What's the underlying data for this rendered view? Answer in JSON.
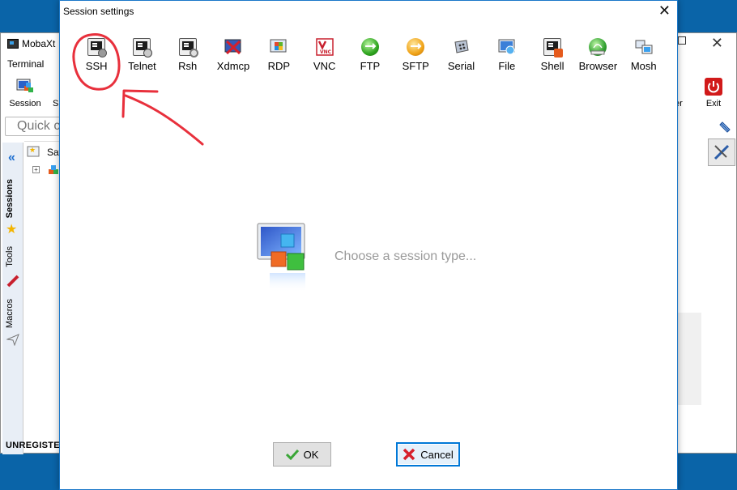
{
  "background_window": {
    "title": "MobaXt",
    "menu": "Terminal",
    "tools": [
      {
        "label": "Session",
        "icon": "session-icon"
      },
      {
        "label": "S",
        "icon": "servers-icon"
      },
      {
        "label": "er",
        "icon": "viewer-icon"
      },
      {
        "label": "Exit",
        "icon": "power-icon"
      }
    ],
    "quick_connect_placeholder": "Quick c",
    "saved_sessions_label": "Sav",
    "side_tabs": [
      "Sessions",
      "Tools",
      "Macros"
    ],
    "status": "UNREGISTER"
  },
  "dialog": {
    "title": "Session settings",
    "session_types": [
      {
        "label": "SSH",
        "icon": "ssh-icon"
      },
      {
        "label": "Telnet",
        "icon": "telnet-icon"
      },
      {
        "label": "Rsh",
        "icon": "rsh-icon"
      },
      {
        "label": "Xdmcp",
        "icon": "xdmcp-icon"
      },
      {
        "label": "RDP",
        "icon": "rdp-icon"
      },
      {
        "label": "VNC",
        "icon": "vnc-icon"
      },
      {
        "label": "FTP",
        "icon": "ftp-icon"
      },
      {
        "label": "SFTP",
        "icon": "sftp-icon"
      },
      {
        "label": "Serial",
        "icon": "serial-icon"
      },
      {
        "label": "File",
        "icon": "file-icon"
      },
      {
        "label": "Shell",
        "icon": "shell-icon"
      },
      {
        "label": "Browser",
        "icon": "browser-icon"
      },
      {
        "label": "Mosh",
        "icon": "mosh-icon"
      }
    ],
    "placeholder_text": "Choose a session type...",
    "ok_label": "OK",
    "cancel_label": "Cancel"
  },
  "vnc_badge": "VNC",
  "colors": {
    "dialog_border": "#1a77c9",
    "desktop": "#0a64a8",
    "annotation": "#e8303c",
    "cancel_border": "#0078d7"
  }
}
